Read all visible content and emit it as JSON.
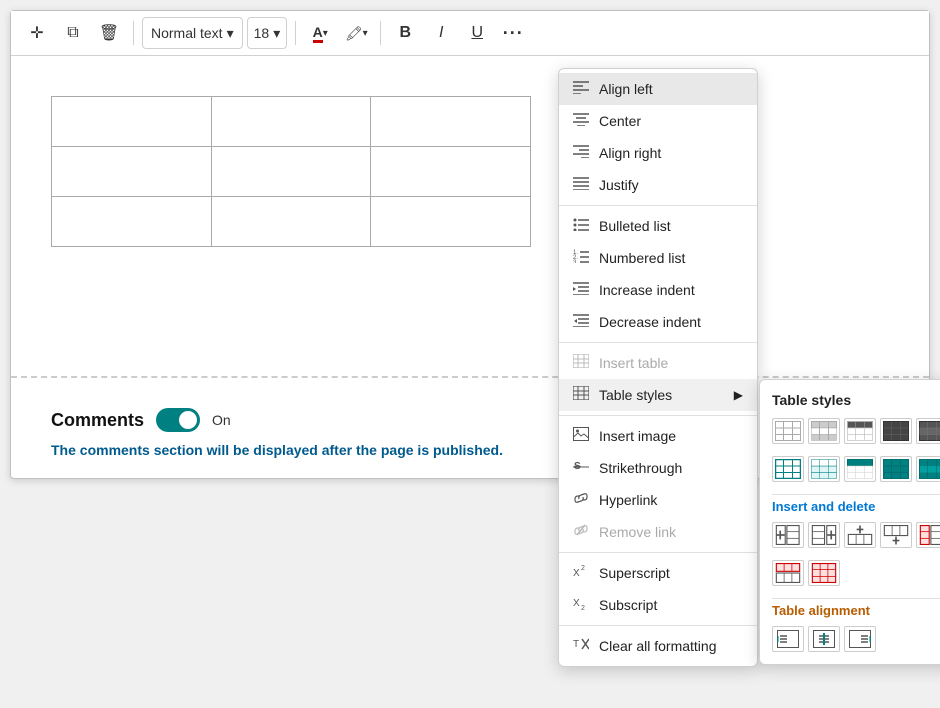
{
  "toolbar": {
    "style_label": "Normal text",
    "font_size": "18",
    "bold_label": "B",
    "italic_label": "I",
    "underline_label": "U",
    "more_label": "···"
  },
  "comments": {
    "label": "Comments",
    "toggle_state": "On",
    "info_text": "The comments section will be displayed after the page is published."
  },
  "dropdown": {
    "items": [
      {
        "id": "align-left",
        "label": "Align left",
        "icon": "≡",
        "active": true
      },
      {
        "id": "center",
        "label": "Center",
        "icon": "≡"
      },
      {
        "id": "align-right",
        "label": "Align right",
        "icon": "≡"
      },
      {
        "id": "justify",
        "label": "Justify",
        "icon": "≡"
      },
      {
        "id": "bulleted-list",
        "label": "Bulleted list",
        "icon": "≔"
      },
      {
        "id": "numbered-list",
        "label": "Numbered list",
        "icon": "≔"
      },
      {
        "id": "increase-indent",
        "label": "Increase indent",
        "icon": "⇥"
      },
      {
        "id": "decrease-indent",
        "label": "Decrease indent",
        "icon": "⇤"
      },
      {
        "id": "insert-table",
        "label": "Insert table",
        "disabled": true
      },
      {
        "id": "table-styles",
        "label": "Table styles",
        "has_arrow": true
      },
      {
        "id": "insert-image",
        "label": "Insert image",
        "icon": "🖼"
      },
      {
        "id": "strikethrough",
        "label": "Strikethrough",
        "icon": "S"
      },
      {
        "id": "hyperlink",
        "label": "Hyperlink",
        "icon": "🔗"
      },
      {
        "id": "remove-link",
        "label": "Remove link",
        "disabled": true
      },
      {
        "id": "superscript",
        "label": "Superscript"
      },
      {
        "id": "subscript",
        "label": "Subscript"
      },
      {
        "id": "clear-formatting",
        "label": "Clear all formatting"
      }
    ]
  },
  "submenu": {
    "title": "Table styles",
    "insert_delete_title": "Insert and delete",
    "alignment_title": "Table alignment"
  }
}
